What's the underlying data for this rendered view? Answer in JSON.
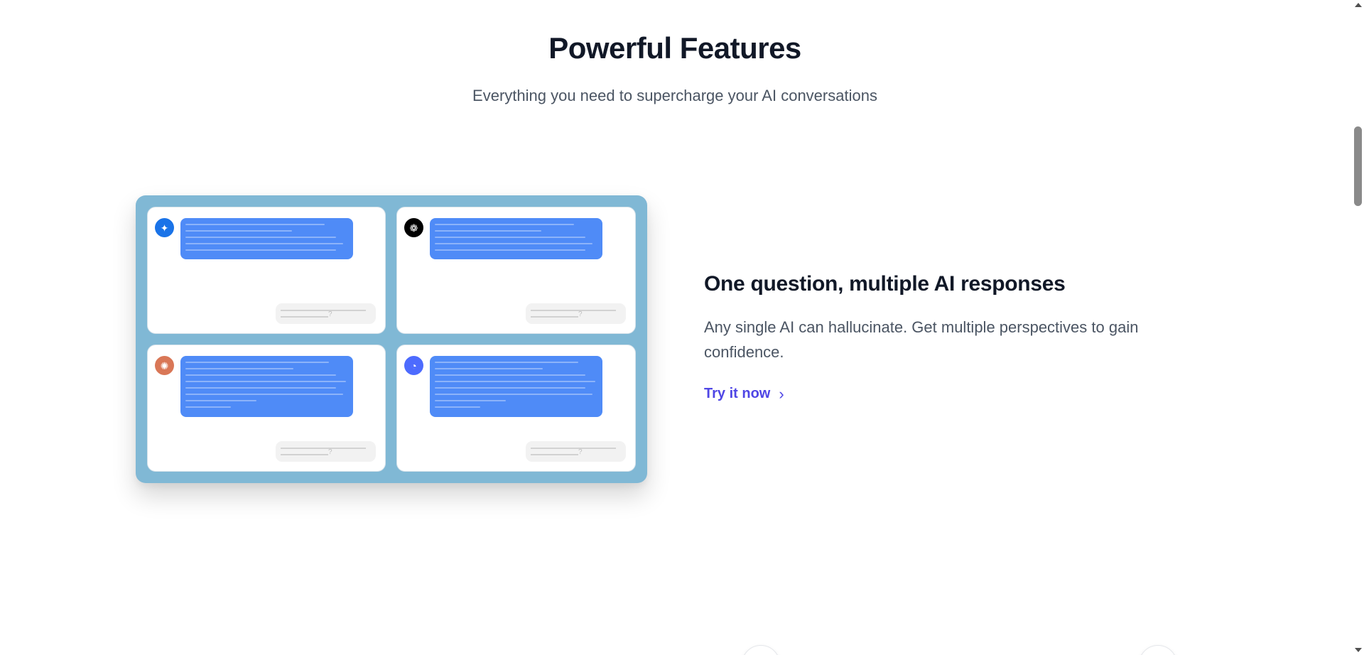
{
  "section": {
    "title": "Powerful Features",
    "subtitle": "Everything you need to supercharge your AI conversations"
  },
  "showcase": {
    "panes": [
      {
        "icon": "gemini-icon",
        "icon_glyph": "✦",
        "icon_color": "#1a73e8",
        "bubble": "short"
      },
      {
        "icon": "chatgpt-icon",
        "icon_glyph": "❁",
        "icon_color": "#000000",
        "bubble": "short"
      },
      {
        "icon": "claude-icon",
        "icon_glyph": "✺",
        "icon_color": "#d97757",
        "bubble": "tall"
      },
      {
        "icon": "deepseek-icon",
        "icon_glyph": "◔",
        "icon_color": "#4d6bfe",
        "bubble": "tall"
      }
    ],
    "prompt_mark": "?",
    "background_color": "#80b8d5",
    "bubble_color": "#4f8bf7"
  },
  "feature": {
    "title": "One question, multiple AI responses",
    "description": "Any single AI can hallucinate. Get multiple perspectives to gain confidence.",
    "cta_label": "Try it now",
    "cta_arrow": "›",
    "accent_color": "#4f46e5"
  }
}
